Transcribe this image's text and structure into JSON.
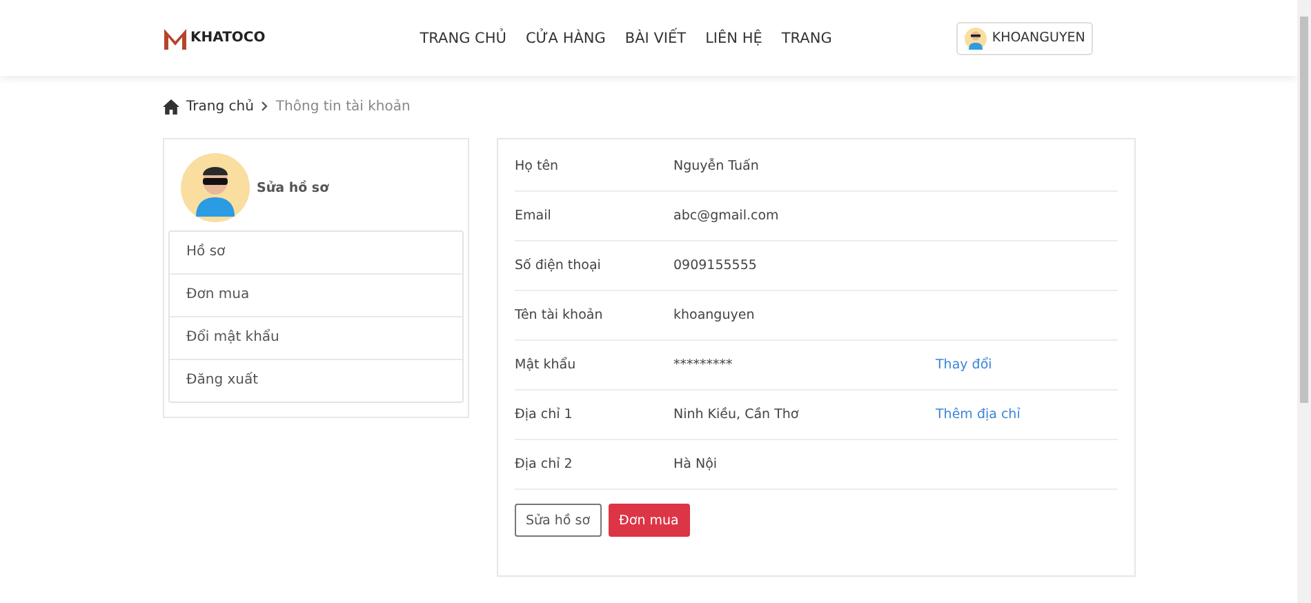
{
  "header": {
    "logo": "KHATOCO",
    "nav": [
      {
        "label": "TRANG CHỦ"
      },
      {
        "label": "CỬA HÀNG"
      },
      {
        "label": "BÀI VIẾT"
      },
      {
        "label": "LIÊN HỆ"
      },
      {
        "label": "TRANG"
      }
    ],
    "user": "KHOANGUYEN"
  },
  "breadcrumb": [
    {
      "label": "Trang chủ",
      "current": false
    },
    {
      "label": "Thông tin tài khoản",
      "current": true
    }
  ],
  "sidebar": {
    "title": "Sửa hồ sơ",
    "items": [
      {
        "label": "Hồ sơ"
      },
      {
        "label": "Đơn mua"
      },
      {
        "label": "Đổi mật khẩu"
      },
      {
        "label": "Đăng xuất"
      }
    ]
  },
  "profile": {
    "rows": [
      {
        "label": "Họ tên",
        "value": "Nguyễn Tuấn"
      },
      {
        "label": "Email",
        "value": "abc@gmail.com"
      },
      {
        "label": "Số điện thoại",
        "value": "0909155555"
      },
      {
        "label": "Tên tài khoản",
        "value": "khoanguyen"
      },
      {
        "label": "Mật khẩu",
        "value": "*********",
        "action": "Thay đổi"
      },
      {
        "label": "Địa chỉ 1",
        "value": "Ninh Kiều, Cần Thơ",
        "action": "Thêm địa chỉ"
      },
      {
        "label": "Địa chỉ 2",
        "value": "Hà Nội"
      }
    ],
    "buttons": [
      {
        "label": "Sửa hồ sơ",
        "kind": "outline"
      },
      {
        "label": "Đơn mua",
        "kind": "primary"
      }
    ]
  }
}
